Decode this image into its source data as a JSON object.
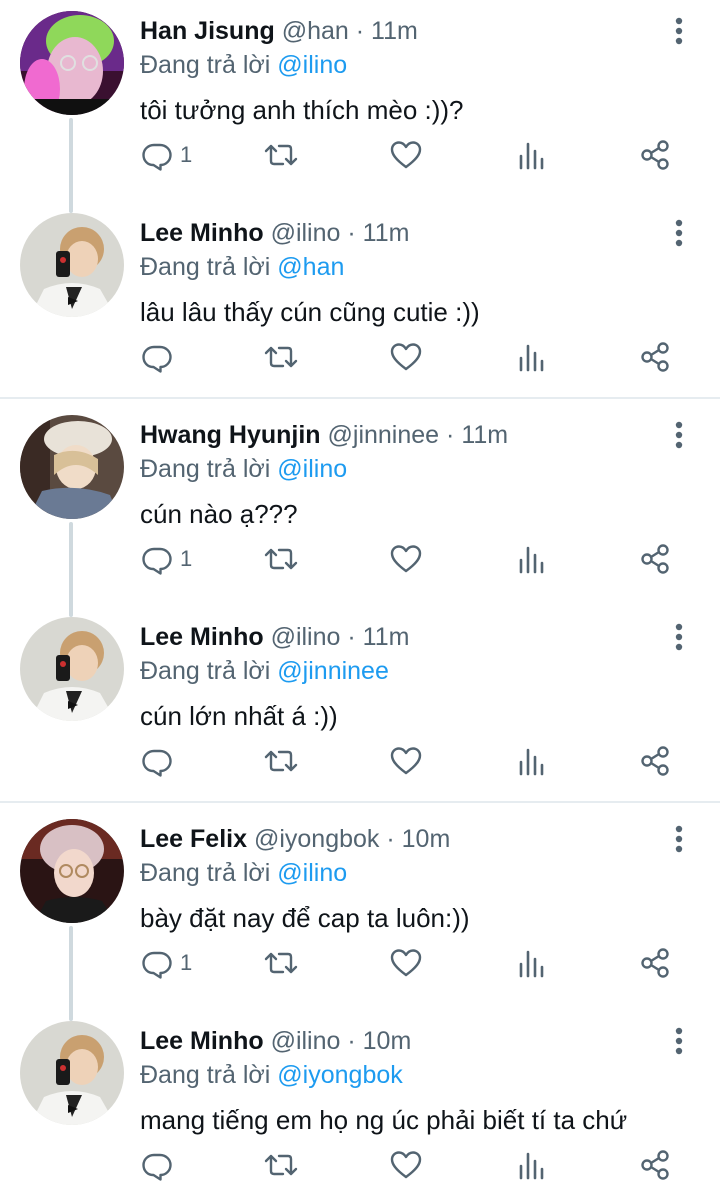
{
  "reply_prefix": "Đang trả lời",
  "tweets": [
    {
      "name": "Han Jisung",
      "handle": "@han",
      "time": "11m",
      "reply_to": "@ilino",
      "text": "tôi tưởng anh thích mèo :))?",
      "reply_count": "1",
      "avatar": "avatar-han-jisung"
    },
    {
      "name": "Lee Minho",
      "handle": "@ilino",
      "time": "11m",
      "reply_to": "@han",
      "text": "lâu lâu thấy cún cũng cutie :))",
      "reply_count": "",
      "avatar": "avatar-lee-minho"
    },
    {
      "name": "Hwang Hyunjin",
      "handle": "@jinninee",
      "time": "11m",
      "reply_to": "@ilino",
      "text": "cún nào ạ???",
      "reply_count": "1",
      "avatar": "avatar-hwang-hyunjin"
    },
    {
      "name": "Lee Minho",
      "handle": "@ilino",
      "time": "11m",
      "reply_to": "@jinninee",
      "text": "cún lớn nhất á :))",
      "reply_count": "",
      "avatar": "avatar-lee-minho"
    },
    {
      "name": "Lee Felix",
      "handle": "@iyongbok",
      "time": "10m",
      "reply_to": "@ilino",
      "text": "bày đặt nay để cap ta luôn:))",
      "reply_count": "1",
      "avatar": "avatar-lee-felix"
    },
    {
      "name": "Lee Minho",
      "handle": "@ilino",
      "time": "10m",
      "reply_to": "@iyongbok",
      "text": "mang tiếng em họ ng úc phải biết tí ta chứ",
      "reply_count": "",
      "avatar": "avatar-lee-minho"
    }
  ],
  "icons": {
    "reply": "reply-icon",
    "retweet": "retweet-icon",
    "like": "heart-icon",
    "views": "views-icon",
    "share": "share-icon",
    "more": "more-vertical-icon"
  },
  "colors": {
    "mention": "#1d9bf0",
    "secondary_text": "#536471",
    "primary_text": "#0f1419",
    "thread_line": "#cfd9de",
    "divider": "#e6ecf0"
  }
}
